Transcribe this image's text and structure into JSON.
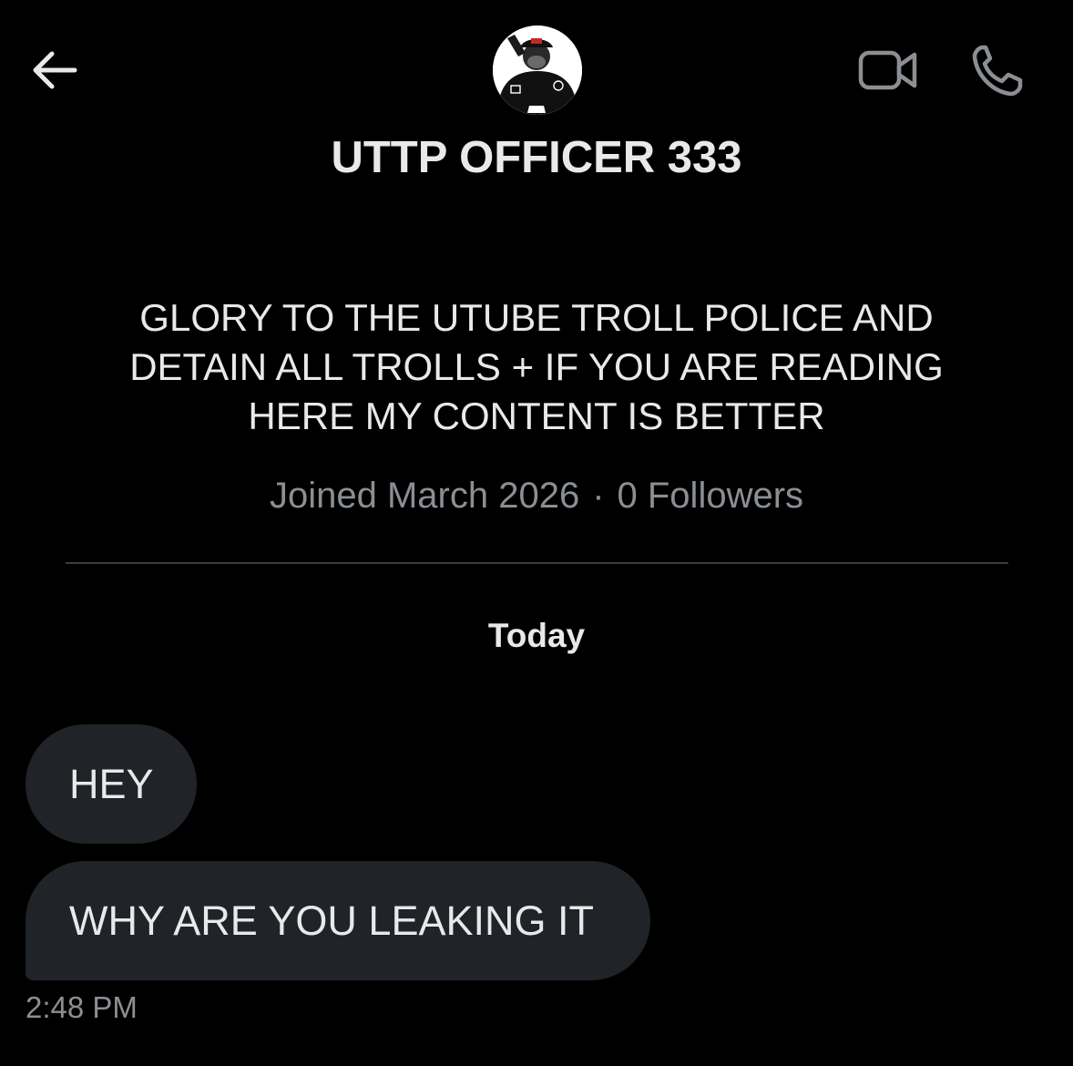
{
  "header": {
    "back_icon": "arrow-left-icon",
    "video_icon": "video-camera-icon",
    "call_icon": "phone-icon",
    "avatar_icon": "profile-avatar"
  },
  "profile": {
    "name": "UTTP OFFICER 333",
    "bio": "GLORY TO THE UTUBE TROLL POLICE AND DETAIN ALL TROLLS + IF YOU ARE READING HERE MY CONTENT IS BETTER",
    "joined": "Joined March 2026",
    "separator": "·",
    "followers": "0 Followers"
  },
  "conversation": {
    "date_label": "Today",
    "messages": [
      {
        "text": "HEY"
      },
      {
        "text": "WHY ARE YOU LEAKING IT"
      }
    ],
    "last_timestamp": "2:48 PM"
  },
  "colors": {
    "background": "#000000",
    "text_primary": "#e7e9ea",
    "text_secondary": "#8b8f93",
    "bubble": "#202327",
    "divider": "#3a3d40"
  }
}
